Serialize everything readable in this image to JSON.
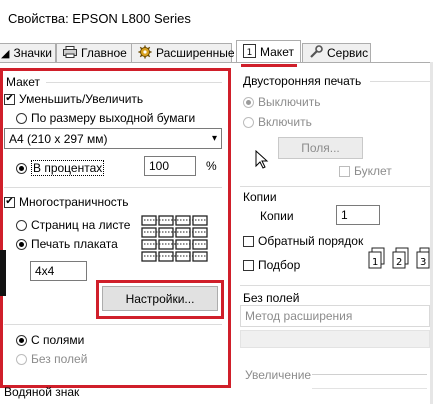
{
  "window": {
    "title": "Свойства: EPSON L800 Series"
  },
  "tabs": [
    {
      "label": "Значки",
      "icon": "partial-icon"
    },
    {
      "label": "Главное",
      "icon": "printer-icon"
    },
    {
      "label": "Расширенные",
      "icon": "gear-icon"
    },
    {
      "label": "Макет",
      "icon": "page-layout-icon"
    },
    {
      "label": "Сервис",
      "icon": "wrench-icon"
    }
  ],
  "layout": {
    "group_label": "Макет",
    "reduce_enlarge": {
      "label": "Уменьшить/Увеличить",
      "checked": true
    },
    "fit_to_page": {
      "label": "По размеру выходной бумаги",
      "selected": false
    },
    "paper_select": {
      "value": "A4 (210 x 297 мм)"
    },
    "percent": {
      "label": "В процентах",
      "selected": true,
      "value": "100",
      "unit": "%"
    },
    "multipage": {
      "label": "Многостраничность",
      "checked": true
    },
    "pages_per_sheet": {
      "label": "Страниц на листе",
      "selected": false
    },
    "poster": {
      "label": "Печать плаката",
      "selected": true
    },
    "poster_size": {
      "value": "4x4"
    },
    "settings_button": "Настройки...",
    "with_margins": {
      "label": "С полями",
      "selected": true
    },
    "borderless": {
      "label": "Без полей",
      "selected": false
    },
    "watermark_label": "Водяной знак"
  },
  "duplex": {
    "group_label": "Двусторонняя печать",
    "off": {
      "label": "Выключить",
      "selected": true
    },
    "on": {
      "label": "Включить",
      "selected": false
    },
    "margins_button": "Поля...",
    "booklet": {
      "label": "Буклет",
      "checked": false
    }
  },
  "copies": {
    "group_label": "Копии",
    "copies_label": "Копии",
    "copies_value": "1",
    "reverse_order": {
      "label": "Обратный порядок",
      "checked": false
    },
    "collate": {
      "label": "Подбор",
      "checked": false
    }
  },
  "borderless_group": {
    "group_label": "Без полей",
    "expansion_label": "Метод расширения",
    "zoom_label": "Увеличение"
  },
  "colors": {
    "highlight": "#d01f2a"
  }
}
